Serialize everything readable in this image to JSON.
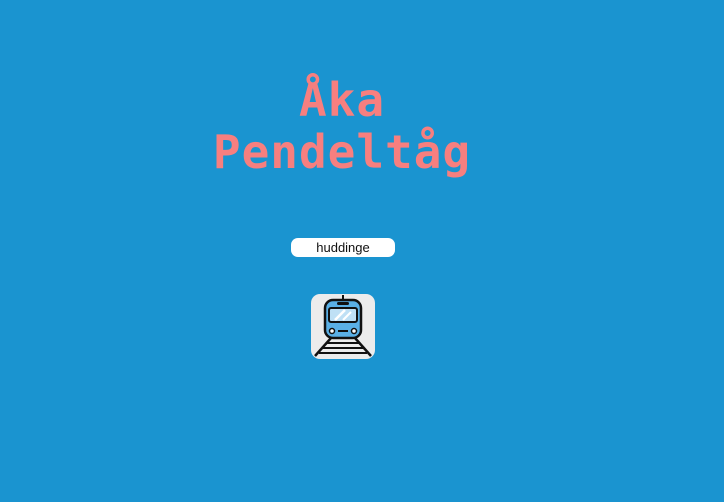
{
  "header": {
    "title_line1": "Åka",
    "title_line2": "Pendeltåg"
  },
  "search": {
    "value": "huddinge",
    "placeholder": ""
  },
  "action": {
    "icon": "train-icon"
  },
  "colors": {
    "background": "#1a94d0",
    "title": "#f77f7f",
    "input_background": "#ffffff",
    "button_background": "#ececec",
    "train_blue": "#5ab0e6"
  }
}
